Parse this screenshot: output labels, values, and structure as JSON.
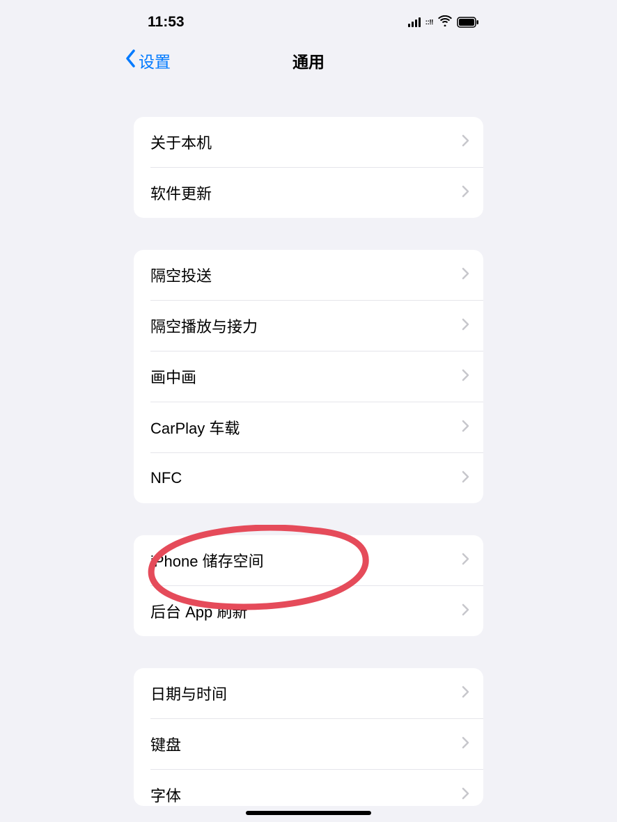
{
  "status_bar": {
    "time": "11:53"
  },
  "nav": {
    "back_label": "设置",
    "title": "通用"
  },
  "sections": [
    {
      "items": [
        {
          "label": "关于本机"
        },
        {
          "label": "软件更新"
        }
      ]
    },
    {
      "items": [
        {
          "label": "隔空投送"
        },
        {
          "label": "隔空播放与接力"
        },
        {
          "label": "画中画"
        },
        {
          "label": "CarPlay 车载"
        },
        {
          "label": "NFC"
        }
      ]
    },
    {
      "items": [
        {
          "label": "iPhone 储存空间"
        },
        {
          "label": "后台 App 刷新"
        }
      ]
    },
    {
      "items": [
        {
          "label": "日期与时间"
        },
        {
          "label": "键盘"
        },
        {
          "label": "字体"
        }
      ]
    }
  ]
}
